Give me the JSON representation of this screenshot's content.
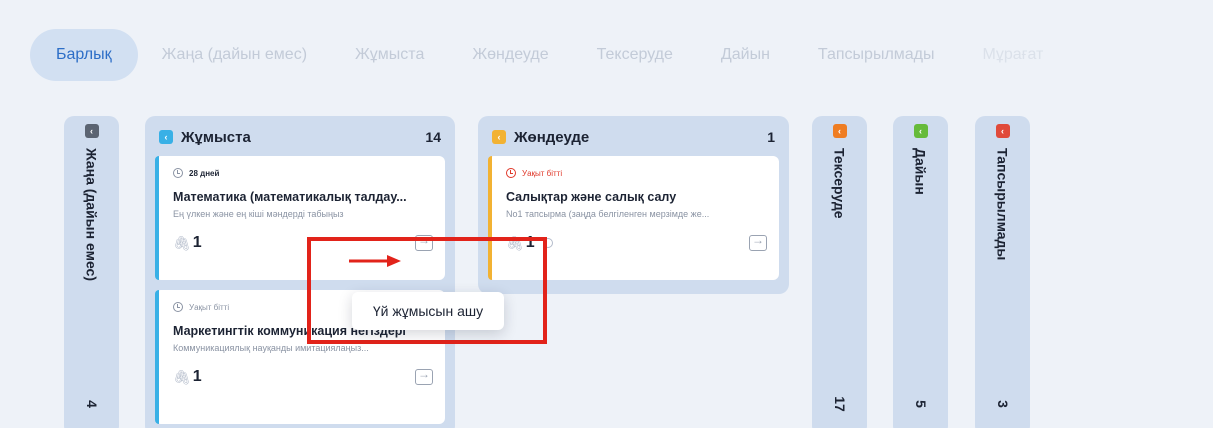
{
  "tabs": [
    {
      "label": "Барлық"
    },
    {
      "label": "Жаңа (дайын емес)"
    },
    {
      "label": "Жұмыста"
    },
    {
      "label": "Жөндеуде"
    },
    {
      "label": "Тексеруде"
    },
    {
      "label": "Дайын"
    },
    {
      "label": "Тапсырылмады"
    },
    {
      "label": "Мұрағат"
    }
  ],
  "columns": {
    "new": {
      "title": "Жаңа (дайын емес)",
      "count": "4",
      "color": "#5b6472"
    },
    "in_work": {
      "title": "Жұмыста",
      "count": "14",
      "color": "#38b0e6"
    },
    "repair": {
      "title": "Жөндеуде",
      "count": "1",
      "color": "#f2b233"
    },
    "review": {
      "title": "Тексеруде",
      "count": "17",
      "color": "#ef7d22"
    },
    "done": {
      "title": "Дайын",
      "count": "5",
      "color": "#66bb3a"
    },
    "not_submitted": {
      "title": "Тапсырылмады",
      "count": "3",
      "color": "#e04a3a"
    }
  },
  "cards": [
    {
      "deadline": "28 дней",
      "title": "Математика (математикалық талдау...",
      "desc": "Ең үлкен және ең кіші мәндерді табыңыз",
      "attachments": "1"
    },
    {
      "deadline": "Уақыт бітті",
      "title": "Маркетингтік коммуникация негіздері",
      "desc": "Коммуникациялық науқанды имитациялаңыз...",
      "attachments": "1"
    },
    {
      "deadline": "Уақыт бітті",
      "title": "Салықтар және салық салу",
      "desc": "No1 тапсырма (заңда белгіленген мерзімде же...",
      "attachments": "1"
    }
  ],
  "tooltip": "Үй жұмысын ашу",
  "colors": {
    "accent": "#2d6ec7",
    "overdue": "#e0392b",
    "highlight": "#e2231a"
  }
}
